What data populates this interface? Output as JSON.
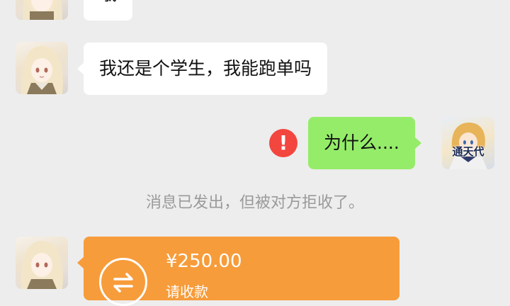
{
  "messages": [
    {
      "side": "left",
      "text": "哦"
    },
    {
      "side": "left",
      "text": "我还是个学生，我能跑单吗"
    },
    {
      "side": "right",
      "text": "为什么....",
      "status": "failed"
    }
  ],
  "system_note": "消息已发出，但被对方拒收了。",
  "transfer": {
    "amount": "¥250.00",
    "subtitle": "请收款"
  },
  "avatars": {
    "self_badge": "通天代"
  },
  "colors": {
    "background": "#ededed",
    "self_bubble": "#95ec69",
    "other_bubble": "#ffffff",
    "transfer_card": "#f79c3a",
    "error": "#f2463f",
    "system_text": "#9a9a9a"
  }
}
